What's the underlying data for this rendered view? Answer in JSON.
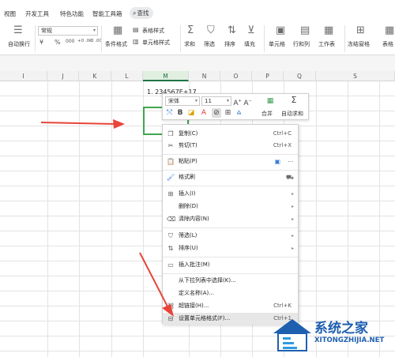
{
  "tabs": [
    "视图",
    "开发工具",
    "特色功能",
    "智能工具箱"
  ],
  "search_label": "查找",
  "ribbon": {
    "auto_wrap": "自动换行",
    "number_format": "常规",
    "currency_symbol": "¥",
    "percent_symbol": "%",
    "thousands_symbol": "000",
    "decimal_inc": "+0 .00",
    "decimal_dec": "-0 .00",
    "conditional_format": "条件格式",
    "table_style": "表格样式",
    "cell_style": "单元格样式",
    "sum": "求和",
    "filter": "筛选",
    "sort": "排序",
    "fill": "填充",
    "cell": "单元格",
    "row_col": "行和列",
    "worksheet": "工作表",
    "freeze": "冻结窗格",
    "table_tools": "表格"
  },
  "columns": [
    "I",
    "J",
    "K",
    "L",
    "M",
    "N",
    "O",
    "P",
    "Q",
    "S"
  ],
  "active_column": "M",
  "cell_text": "1. 234567E+17",
  "mini_toolbar": {
    "font": "宋体",
    "size": "11",
    "merge": "合并",
    "autosum": "自动求和"
  },
  "menu": [
    {
      "icon": "copy-icon",
      "glyph": "❐",
      "label": "复制(C)",
      "shortcut": "Ctrl+C"
    },
    {
      "icon": "cut-icon",
      "glyph": "✂",
      "label": "剪切(T)",
      "shortcut": "Ctrl+X"
    },
    {
      "icon": "paste-icon",
      "glyph": "📋",
      "label": "粘贴(P)",
      "shortcut": ""
    },
    {
      "icon": "format-painter-icon",
      "glyph": "🖌",
      "label": "格式刷",
      "shortcut": ""
    },
    {
      "icon": "insert-icon",
      "glyph": "⊞",
      "label": "插入(I)",
      "shortcut": ""
    },
    {
      "icon": "delete-icon",
      "glyph": "",
      "label": "删除(D)",
      "shortcut": ""
    },
    {
      "icon": "clear-icon",
      "glyph": "⌫",
      "label": "清除内容(N)",
      "shortcut": ""
    },
    {
      "icon": "filter-icon",
      "glyph": "⛉",
      "label": "筛选(L)",
      "shortcut": ""
    },
    {
      "icon": "sort-icon",
      "glyph": "⇅",
      "label": "排序(U)",
      "shortcut": ""
    },
    {
      "icon": "comment-icon",
      "glyph": "▭",
      "label": "插入批注(M)",
      "shortcut": ""
    },
    {
      "icon": "",
      "glyph": "",
      "label": "从下拉列表中选择(K)...",
      "shortcut": ""
    },
    {
      "icon": "",
      "glyph": "",
      "label": "定义名称(A)...",
      "shortcut": ""
    },
    {
      "icon": "hyperlink-icon",
      "glyph": "⛓",
      "label": "超链接(H)...",
      "shortcut": "Ctrl+K"
    },
    {
      "icon": "format-cells-icon",
      "glyph": "⊟",
      "label": "设置单元格格式(F)...",
      "shortcut": "Ctrl+1"
    }
  ],
  "watermark": {
    "cn": "系统之家",
    "en": "XITONGZHIJIA.NET"
  },
  "colors": {
    "accent_green": "#3fa652",
    "arrow_red": "#e8443a",
    "watermark_blue": "#1f5fb0"
  }
}
